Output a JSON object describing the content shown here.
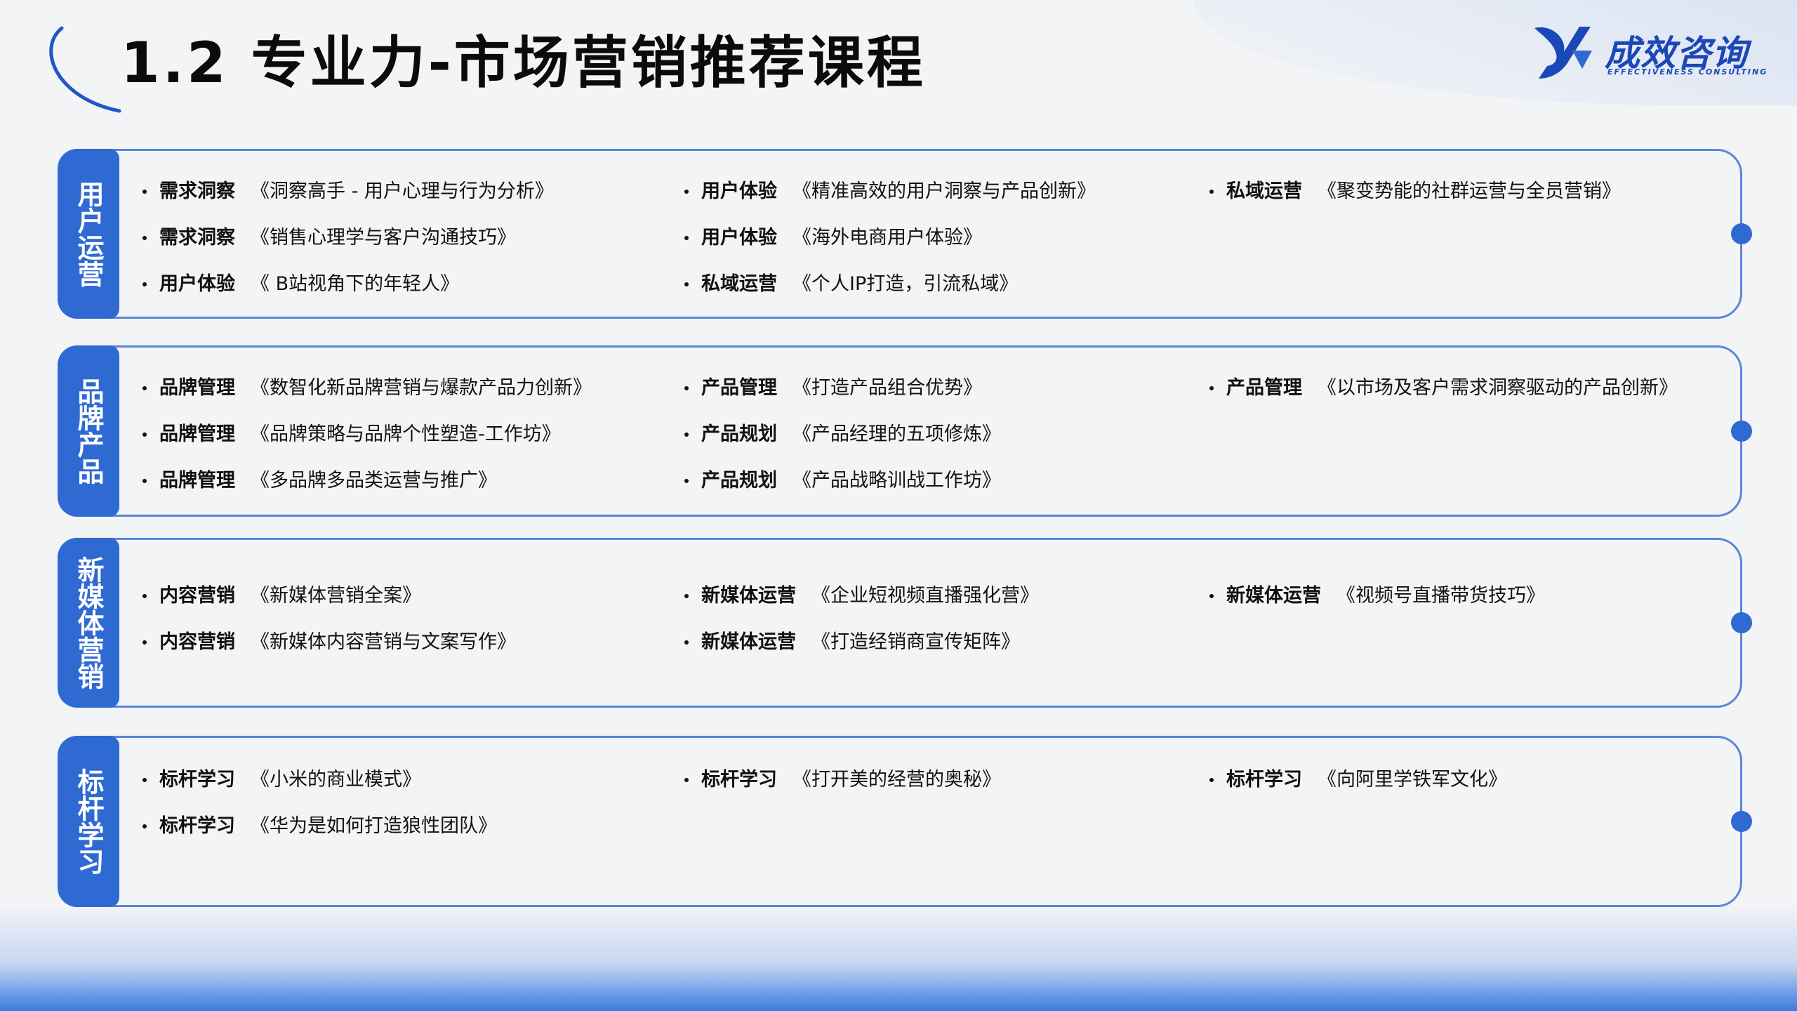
{
  "title": "1.2 专业力-市场营销推荐课程",
  "logo": {
    "name": "成效咨询",
    "tagline": "EFFECTIVENESS CONSULTING"
  },
  "colors": {
    "accent": "#2f6ad3",
    "border": "#5b86d8",
    "brand": "#1b48b8"
  },
  "sections": [
    {
      "label": "用户运营",
      "columns": [
        [
          {
            "category": "需求洞察",
            "course": "《洞察高手 - 用户心理与行为分析》"
          },
          {
            "category": "需求洞察",
            "course": "《销售心理学与客户沟通技巧》"
          },
          {
            "category": "用户体验",
            "course": "《 B站视角下的年轻人》"
          }
        ],
        [
          {
            "category": "用户体验",
            "course": "《精准高效的用户洞察与产品创新》"
          },
          {
            "category": "用户体验",
            "course": "《海外电商用户体验》"
          },
          {
            "category": "私域运营",
            "course": "《个人IP打造，引流私域》"
          }
        ],
        [
          {
            "category": "私域运营",
            "course": "《聚变势能的社群运营与全员营销》"
          }
        ]
      ]
    },
    {
      "label": "品牌产品",
      "columns": [
        [
          {
            "category": "品牌管理",
            "course": "《数智化新品牌营销与爆款产品力创新》"
          },
          {
            "category": "品牌管理",
            "course": "《品牌策略与品牌个性塑造-工作坊》"
          },
          {
            "category": "品牌管理",
            "course": "《多品牌多品类运营与推广》"
          }
        ],
        [
          {
            "category": "产品管理",
            "course": "《打造产品组合优势》"
          },
          {
            "category": "产品规划",
            "course": "《产品经理的五项修炼》"
          },
          {
            "category": "产品规划",
            "course": "《产品战略训战工作坊》"
          }
        ],
        [
          {
            "category": "产品管理",
            "course": "《以市场及客户需求洞察驱动的产品创新》"
          }
        ]
      ]
    },
    {
      "label": "新媒体营销",
      "columns": [
        [
          {
            "category": "内容营销",
            "course": "《新媒体营销全案》"
          },
          {
            "category": "内容营销",
            "course": "《新媒体内容营销与文案写作》"
          }
        ],
        [
          {
            "category": "新媒体运营",
            "course": "《企业短视频直播强化营》"
          },
          {
            "category": "新媒体运营",
            "course": "《打造经销商宣传矩阵》"
          }
        ],
        [
          {
            "category": "新媒体运营",
            "course": "《视频号直播带货技巧》"
          }
        ]
      ]
    },
    {
      "label": "标杆学习",
      "columns": [
        [
          {
            "category": "标杆学习",
            "course": "《小米的商业模式》"
          },
          {
            "category": "标杆学习",
            "course": "《华为是如何打造狼性团队》"
          }
        ],
        [
          {
            "category": "标杆学习",
            "course": "《打开美的经营的奥秘》"
          }
        ],
        [
          {
            "category": "标杆学习",
            "course": "《向阿里学铁军文化》"
          }
        ]
      ]
    }
  ]
}
